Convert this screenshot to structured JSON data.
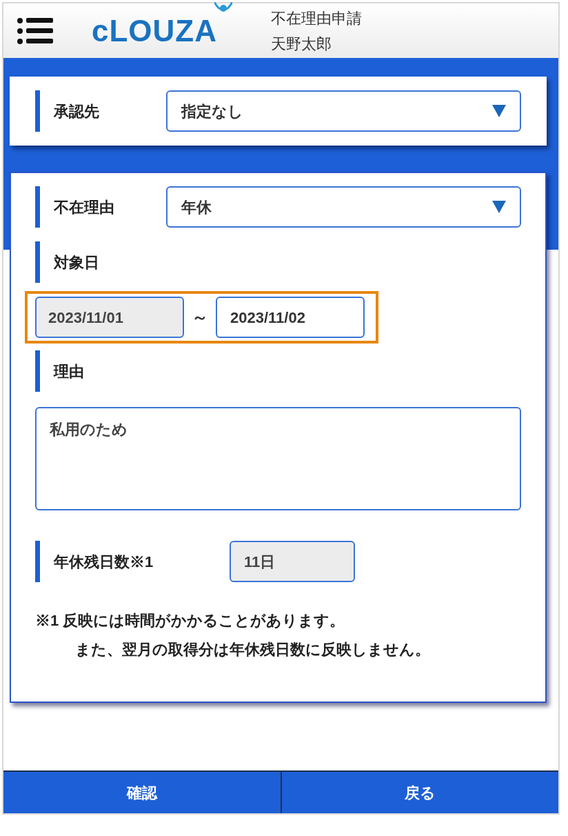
{
  "header": {
    "logo": "cLOUZA",
    "title": "不在理由申請",
    "user": "天野太郎"
  },
  "approver": {
    "label": "承認先",
    "value": "指定なし"
  },
  "form": {
    "reason_type": {
      "label": "不在理由",
      "value": "年休"
    },
    "date": {
      "label": "対象日",
      "from": "2023/11/01",
      "separator": "～",
      "to": "2023/11/02"
    },
    "reason": {
      "label": "理由",
      "value": "私用のため"
    },
    "remaining": {
      "label": "年休残日数※1",
      "value": "11日"
    },
    "notes": [
      "※1 反映には時間がかかることがあります。",
      "また、翌月の取得分は年休残日数に反映しません。"
    ]
  },
  "buttons": [
    "確認",
    "戻る"
  ]
}
